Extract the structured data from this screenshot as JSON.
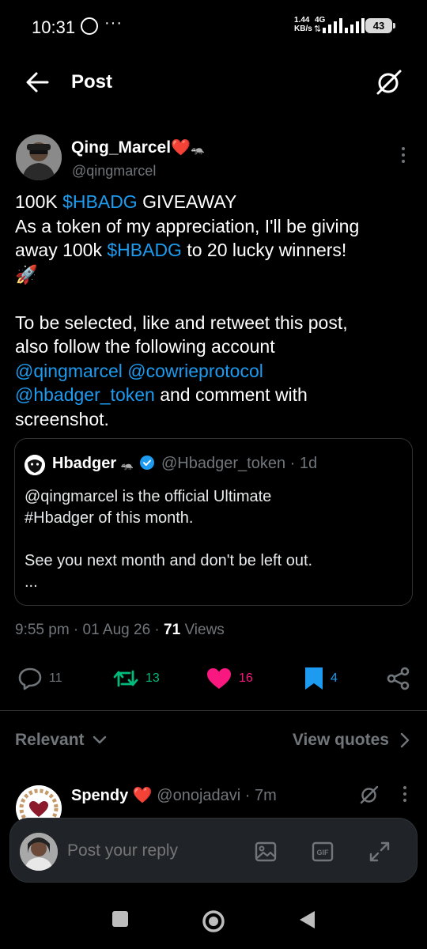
{
  "status_bar": {
    "time": "10:31",
    "dots": "···",
    "net_speed_value": "1.44",
    "net_speed_unit": "KB/s",
    "network": "4G",
    "battery": "43"
  },
  "header": {
    "title": "Post"
  },
  "post": {
    "author_name": "Qing_Marcel",
    "author_heart": "❤️",
    "author_emoji": "🦡",
    "author_handle": "@qingmarcel",
    "lines": [
      {
        "t1": "100K ",
        "link": "$HBADG",
        "t2": " GIVEAWAY"
      },
      {
        "t1": "As a token of my appreciation, I'll be giving"
      },
      {
        "t1": "away 100k ",
        "link": "$HBADG",
        "t2": " to 20 lucky winners!"
      },
      {
        "t1": "🚀"
      }
    ],
    "lines2": [
      {
        "t1": "To be selected, like and retweet this post,"
      },
      {
        "t1": "also follow the following account"
      },
      {
        "link": "@qingmarcel",
        "t2": " ",
        "link2": "@cowrieprotocol"
      },
      {
        "link": "@hbadger_token",
        "t2": " and comment with"
      },
      {
        "t1": "screenshot."
      }
    ],
    "time": "9:55 pm",
    "date": "01 Aug 26",
    "views_count": "71",
    "views_label": "Views"
  },
  "quote": {
    "name": "Hbadger",
    "emoji": "🦡",
    "handle": "@Hbadger_token",
    "age": "1d",
    "line1": "@qingmarcel is the official Ultimate",
    "line2": "#Hbadger of this month.",
    "line3": "See you next month and don't be left out.",
    "line4": "..."
  },
  "actions": {
    "replies": "11",
    "reposts": "13",
    "likes": "16",
    "bookmarks": "4"
  },
  "filters": {
    "relevant": "Relevant",
    "view_quotes": "View quotes"
  },
  "reply_preview": {
    "name": "Spendy",
    "heart": "❤️",
    "handle": "@onojadavi",
    "age": "7m"
  },
  "compose": {
    "placeholder": "Post your reply",
    "gif_label": "GIF"
  },
  "colors": {
    "background": "#000000",
    "link": "#1d9bf0",
    "muted": "#71767b",
    "repost_green": "#00ba7c",
    "like_pink": "#f91880",
    "bookmark_blue": "#1d9bf0"
  }
}
